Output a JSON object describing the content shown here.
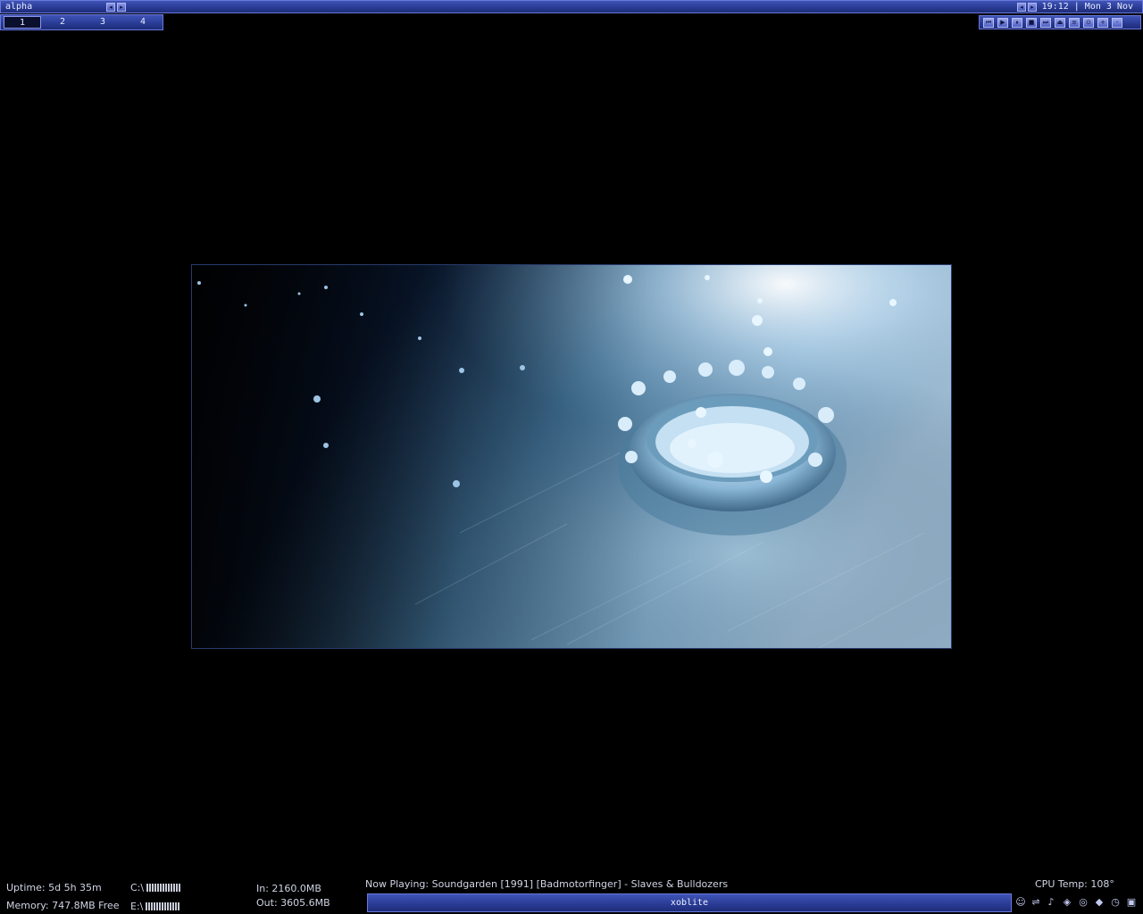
{
  "topbar": {
    "window_title": "alpha",
    "clock": "19:12  |  Mon 3 Nov",
    "nav_left": "◂",
    "nav_right": "▸"
  },
  "workspaces": [
    {
      "label": "1",
      "active": true
    },
    {
      "label": "2",
      "active": false
    },
    {
      "label": "3",
      "active": false
    },
    {
      "label": "4",
      "active": false
    }
  ],
  "media_buttons": [
    {
      "name": "previous-icon",
      "glyph": "⏮"
    },
    {
      "name": "play-icon",
      "glyph": "▶"
    },
    {
      "name": "pause-icon",
      "glyph": "⏸"
    },
    {
      "name": "stop-icon",
      "glyph": "■"
    },
    {
      "name": "next-icon",
      "glyph": "⏭"
    },
    {
      "name": "eject-icon",
      "glyph": "⏏"
    },
    {
      "name": "playlist-icon",
      "glyph": "≡"
    },
    {
      "name": "options-icon",
      "glyph": "⊙"
    },
    {
      "name": "volume-up-icon",
      "glyph": "+"
    },
    {
      "name": "volume-down-icon",
      "glyph": "-"
    }
  ],
  "stats": {
    "uptime": "Uptime: 5d 5h 35m",
    "memory": "Memory: 747.8MB Free",
    "drive_c": "C:\\",
    "drive_e": "E:\\",
    "net_in": "In: 2160.0MB",
    "net_out": "Out: 3605.6MB",
    "now_playing": "Now Playing: Soundgarden [1991] [Badmotorfinger] - Slaves & Bulldozers",
    "cpu_temp": "CPU Temp: 108°"
  },
  "taskbar": {
    "label": "xoblite"
  },
  "tray_icons": [
    "user-icon",
    "network-icon",
    "speaker-icon",
    "satellite-icon",
    "globe-icon",
    "shield-icon",
    "clock-icon",
    "app-icon"
  ],
  "colors": {
    "accent": "#2a3c96",
    "accent_light": "#6878d8",
    "background": "#000000"
  }
}
